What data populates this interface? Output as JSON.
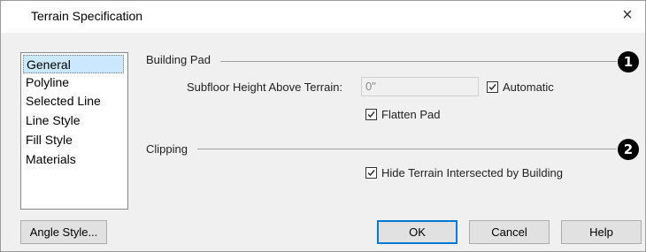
{
  "window": {
    "title": "Terrain Specification",
    "close_glyph": "×"
  },
  "sidebar": {
    "items": [
      {
        "label": "General",
        "selected": true
      },
      {
        "label": "Polyline",
        "selected": false
      },
      {
        "label": "Selected Line",
        "selected": false
      },
      {
        "label": "Line Style",
        "selected": false
      },
      {
        "label": "Fill Style",
        "selected": false
      },
      {
        "label": "Materials",
        "selected": false
      }
    ]
  },
  "building_pad": {
    "group_label": "Building Pad",
    "badge": "1",
    "subfloor_label": "Subfloor Height Above Terrain:",
    "subfloor_value": "0\"",
    "automatic_label": "Automatic",
    "automatic_checked": true,
    "flatten_label": "Flatten Pad",
    "flatten_checked": true
  },
  "clipping": {
    "group_label": "Clipping",
    "badge": "2",
    "hide_label": "Hide Terrain Intersected by Building",
    "hide_checked": true
  },
  "buttons": {
    "angle_style": "Angle Style...",
    "ok": "OK",
    "cancel": "Cancel",
    "help": "Help"
  },
  "colors": {
    "selection": "#cce8ff",
    "default_button_border": "#0078d7",
    "badge": "#000000"
  },
  "icons": {
    "checkmark": "check-icon",
    "close": "close-icon"
  }
}
